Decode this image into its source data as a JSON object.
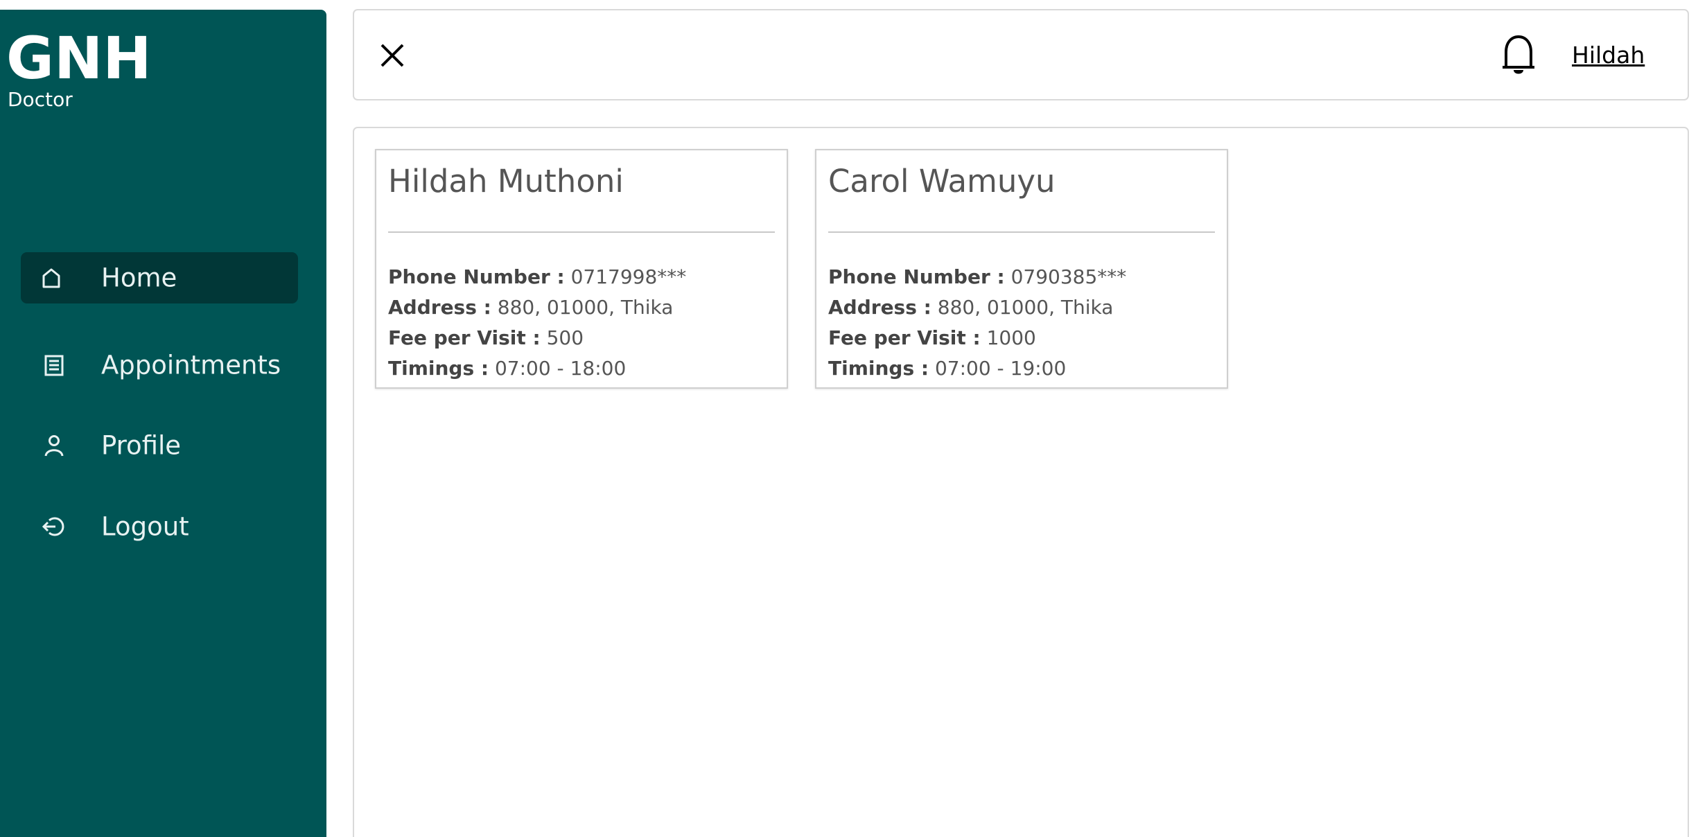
{
  "sidebar": {
    "brand": "GNH",
    "role": "Doctor",
    "bg_color": "#005555",
    "active_bg_color": "#013737",
    "items": [
      {
        "label": "Home",
        "icon": "home-icon",
        "active": true
      },
      {
        "label": "Appointments",
        "icon": "list-icon",
        "active": false
      },
      {
        "label": "Profile",
        "icon": "user-icon",
        "active": false
      },
      {
        "label": "Logout",
        "icon": "logout-icon",
        "active": false
      }
    ]
  },
  "header": {
    "close_icon": "close-icon",
    "notification_icon": "bell-icon",
    "user_name": "Hildah"
  },
  "doctors": [
    {
      "name": "Hildah Muthoni",
      "phone_label": "Phone Number :",
      "phone": "0717998***",
      "address_label": "Address :",
      "address": "880, 01000, Thika",
      "fee_label": "Fee per Visit :",
      "fee": "500",
      "timings_label": "Timings :",
      "timings": "07:00 - 18:00"
    },
    {
      "name": "Carol Wamuyu",
      "phone_label": "Phone Number :",
      "phone": "0790385***",
      "address_label": "Address :",
      "address": "880, 01000, Thika",
      "fee_label": "Fee per Visit :",
      "fee": "1000",
      "timings_label": "Timings :",
      "timings": "07:00 - 19:00"
    }
  ]
}
